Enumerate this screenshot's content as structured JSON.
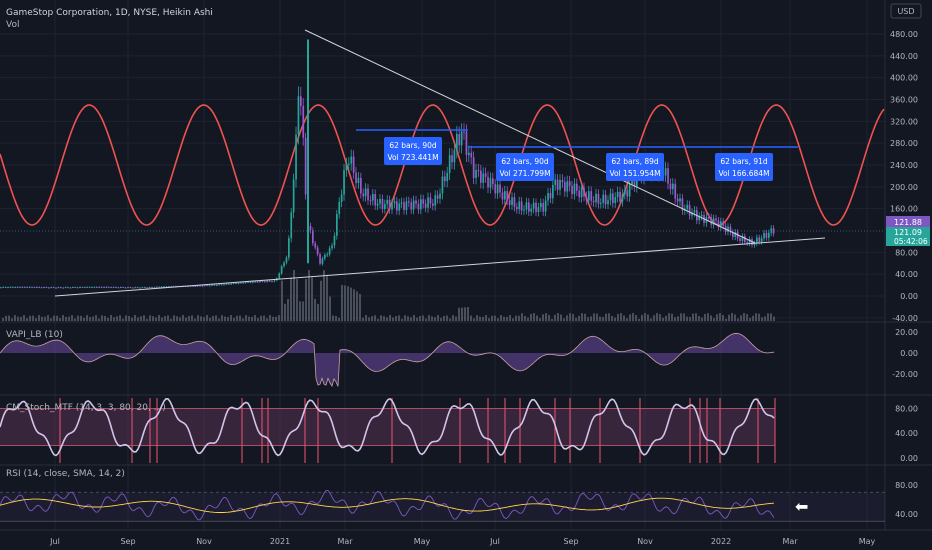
{
  "header": {
    "title": "GameStop Corporation, 1D, NYSE, Heikin Ashi",
    "subtitle": "Vol",
    "currency": "USD"
  },
  "colors": {
    "background": "#131722",
    "grid": "#1f2330",
    "text": "#b2b5be",
    "up": "#26a69a",
    "down": "#9b59d0",
    "sine": "#ef5350",
    "trendline": "#d1d4dc",
    "projection": "#2962ff",
    "box_fill": "#2962ff",
    "rsi_line": "#7e57c2",
    "rsi_ma": "#ffd54f",
    "stoch_line": "#d1c4e9",
    "stoch_band": "#7b3f6e",
    "price_tag": "#7e57c2",
    "countdown_tag": "#26a69a"
  },
  "x_axis": {
    "labels": [
      "Jul",
      "Sep",
      "Nov",
      "2021",
      "Mar",
      "May",
      "Jul",
      "Sep",
      "Nov",
      "2022",
      "Mar",
      "May"
    ]
  },
  "chart_data": [
    {
      "type": "candlestick",
      "title": "GameStop Corporation, 1D, NYSE, Heikin Ashi",
      "y_ticks": [
        "480.00",
        "440.00",
        "400.00",
        "360.00",
        "320.00",
        "280.00",
        "240.00",
        "200.00",
        "160.00",
        "80.00",
        "40.00",
        "0.00",
        "-40.00"
      ],
      "ylim": [
        -40,
        500
      ],
      "last_price": "121.88",
      "price_tag_2": "121.09",
      "countdown": "05:42:06",
      "series_points": [
        [
          "2020-06",
          16
        ],
        [
          "2020-08",
          16
        ],
        [
          "2020-10",
          16
        ],
        [
          "2020-11",
          18
        ],
        [
          "2020-12",
          22
        ],
        [
          "2021-01-10",
          28
        ],
        [
          "2021-01-20",
          80
        ],
        [
          "2021-01-27",
          300
        ],
        [
          "2021-01-29",
          420
        ],
        [
          "2021-02-05",
          130
        ],
        [
          "2021-02-15",
          60
        ],
        [
          "2021-02-25",
          90
        ],
        [
          "2021-03-05",
          200
        ],
        [
          "2021-03-10",
          260
        ],
        [
          "2021-03-20",
          200
        ],
        [
          "2021-04-05",
          170
        ],
        [
          "2021-04-20",
          160
        ],
        [
          "2021-05-05",
          165
        ],
        [
          "2021-05-20",
          180
        ],
        [
          "2021-06-05",
          280
        ],
        [
          "2021-06-10",
          300
        ],
        [
          "2021-06-20",
          220
        ],
        [
          "2021-07-05",
          200
        ],
        [
          "2021-07-25",
          170
        ],
        [
          "2021-08-15",
          160
        ],
        [
          "2021-08-25",
          200
        ],
        [
          "2021-09-10",
          195
        ],
        [
          "2021-10-01",
          180
        ],
        [
          "2021-10-20",
          180
        ],
        [
          "2021-11-05",
          230
        ],
        [
          "2021-11-20",
          240
        ],
        [
          "2021-12-05",
          170
        ],
        [
          "2021-12-20",
          140
        ],
        [
          "2022-01-05",
          130
        ],
        [
          "2022-01-20",
          110
        ],
        [
          "2022-02-01",
          100
        ],
        [
          "2022-02-10",
          110
        ],
        [
          "2022-02-20",
          121
        ]
      ],
      "annotations": [
        {
          "line1": "62 bars, 90d",
          "line2": "Vol 723.441M"
        },
        {
          "line1": "62 bars, 90d",
          "line2": "Vol 271.799M"
        },
        {
          "line1": "62 bars, 89d",
          "line2": "Vol 151.954M"
        },
        {
          "line1": "62 bars, 91d",
          "line2": "Vol 166.684M"
        }
      ],
      "overlays": [
        "sine cycle",
        "descending trendline",
        "ascending trendline",
        "projection ranges"
      ]
    },
    {
      "type": "area",
      "title": "VAPI_LB (10)",
      "y_ticks": [
        "20.00",
        "0.00",
        "-20.00"
      ],
      "ylim": [
        -35,
        30
      ]
    },
    {
      "type": "line",
      "title": "CM_Stoch_MTF (14, 3, 3, 80, 20, ...)",
      "y_ticks": [
        "80.00",
        "40.00",
        "0.00"
      ],
      "ylim": [
        0,
        100
      ],
      "band": [
        20,
        80
      ]
    },
    {
      "type": "line",
      "title": "RSI (14, close, SMA, 14, 2)",
      "y_ticks": [
        "80.00",
        "40.00"
      ],
      "ylim": [
        20,
        90
      ],
      "band": [
        30,
        70
      ]
    }
  ]
}
